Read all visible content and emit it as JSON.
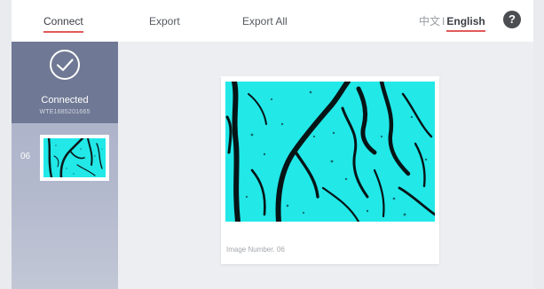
{
  "nav": {
    "connect": "Connect",
    "export": "Export",
    "export_all": "Export All"
  },
  "language": {
    "chinese": "中文",
    "separator": "I",
    "english": "English"
  },
  "help": {
    "glyph": "?"
  },
  "device": {
    "status": "Connected",
    "id": "WTE1685201665"
  },
  "thumbnails": [
    {
      "number": "06"
    }
  ],
  "preview": {
    "caption": "Image Number. 06"
  },
  "colors": {
    "accent_underline": "#e25a5a",
    "sidebar_active": "#6f7894",
    "scan_cyan": "#22e8e8"
  },
  "icons": {
    "connected": "check-circle-icon",
    "help": "question-circle-icon"
  }
}
